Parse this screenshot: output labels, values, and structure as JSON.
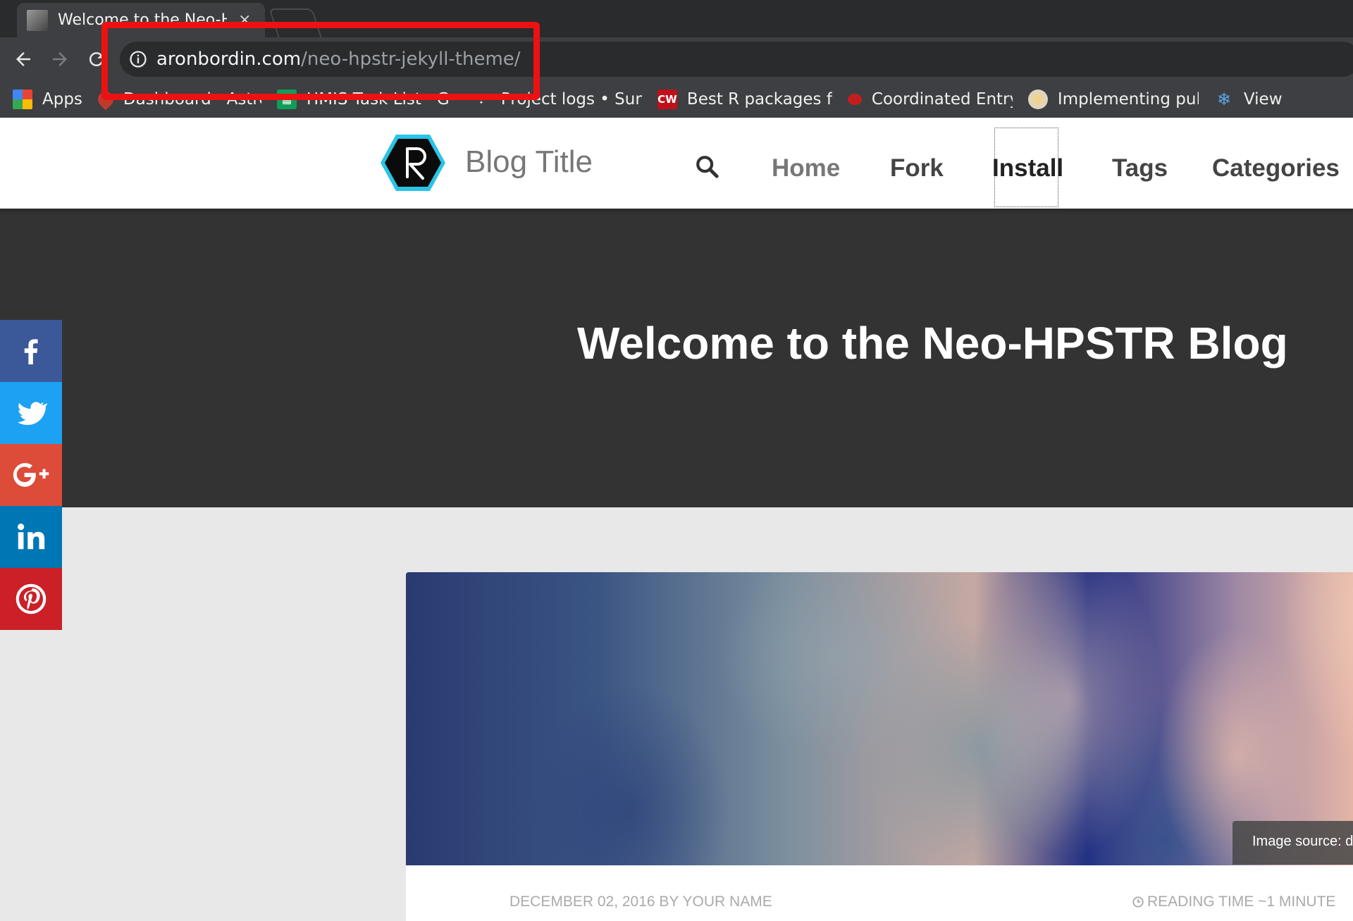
{
  "browser": {
    "tab": {
      "title": "Welcome to the Neo-H",
      "close": "×"
    },
    "toolbar": {
      "back_icon": "back-arrow-icon",
      "forward_icon": "forward-arrow-icon",
      "reload_icon": "reload-icon"
    },
    "url": {
      "host": "aronbordin.com",
      "path": "/neo-hpstr-jekyll-theme/"
    },
    "bookmarks": [
      {
        "label": "Apps",
        "icon": "apps-grid-icon"
      },
      {
        "label": "Dashboard · Astro",
        "icon": "rocket-icon"
      },
      {
        "label": "HMIS Task List · G",
        "icon": "sheets-icon"
      },
      {
        "label": "Project logs • Sun",
        "icon": "dots-icon"
      },
      {
        "label": "Best R packages f",
        "icon": "cw-icon",
        "icon_text": "CW"
      },
      {
        "label": "Coordinated Entry",
        "icon": "bug-icon"
      },
      {
        "label": "Implementing pul",
        "icon": "globe-icon"
      },
      {
        "label": "View",
        "icon": "snowflake-icon"
      }
    ],
    "highlight_color": "#ee1111"
  },
  "header": {
    "blog_title": "Blog Title",
    "nav": [
      "Home",
      "Fork",
      "Install",
      "Tags",
      "Categories"
    ],
    "nav_colors": {
      "home": "#777777",
      "others": "#444444",
      "install": "#222222"
    }
  },
  "hero": {
    "title": "Welcome to the Neo-HPSTR Blog"
  },
  "share": [
    {
      "network": "facebook",
      "color": "#3b5998"
    },
    {
      "network": "twitter",
      "color": "#1da1f2"
    },
    {
      "network": "google-plus",
      "color": "#dd4b39"
    },
    {
      "network": "linkedin",
      "color": "#0077b5"
    },
    {
      "network": "pinterest",
      "color": "#cb2027"
    }
  ],
  "article": {
    "image_source": "Image source: d",
    "date_line": "DECEMBER 02, 2016 BY YOUR NAME",
    "reading_time": "READING TIME ~1 MINUTE"
  }
}
